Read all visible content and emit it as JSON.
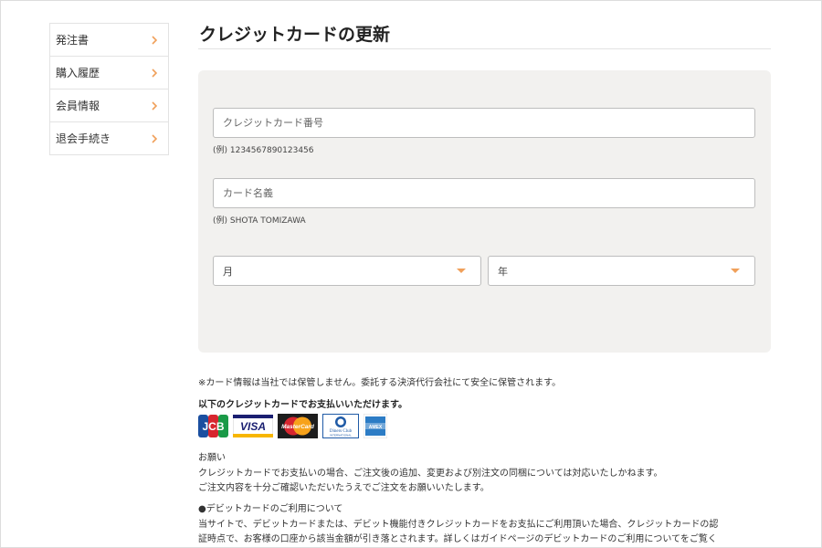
{
  "sidebar": {
    "items": [
      {
        "label": "発注書"
      },
      {
        "label": "購入履歴"
      },
      {
        "label": "会員情報"
      },
      {
        "label": "退会手続き"
      }
    ]
  },
  "page": {
    "title": "クレジットカードの更新"
  },
  "form": {
    "card_number_placeholder": "クレジットカード番号",
    "card_number_hint": "(例) 1234567890123456",
    "card_name_placeholder": "カード名義",
    "card_name_hint": "(例) SHOTA TOMIZAWA",
    "month_label": "月",
    "year_label": "年"
  },
  "info": {
    "notice": "※カード情報は当社では保管しません。委託する決済代行会社にて安全に保管されます。",
    "cards_heading": "以下のクレジットカードでお支払いいただけます。",
    "brands": [
      {
        "label": "JCB",
        "icon": "jcb-logo"
      },
      {
        "label": "VISA",
        "icon": "visa-logo"
      },
      {
        "label": "MasterCard",
        "icon": "mastercard-logo"
      },
      {
        "label": "Diners Club",
        "sublabel": "INTERNATIONAL",
        "icon": "diners-logo"
      },
      {
        "label": "AMEX",
        "icon": "amex-logo"
      }
    ],
    "request_title": "お願い",
    "request_line1": "クレジットカードでお支払いの場合、ご注文後の追加、変更および別注文の同梱については対応いたしかねます。",
    "request_line2": "ご注文内容を十分ご確認いただいたうえでご注文をお願いいたします。",
    "debit_title": "●デビットカードのご利用について",
    "debit_line1": "当サイトで、デビットカードまたは、デビット機能付きクレジットカードをお支払にご利用頂いた場合、クレジットカードの認",
    "debit_line2": "証時点で、お客様の口座から該当金額が引き落とされます。詳しくはガイドページのデビットカードのご利用についてをご覧く"
  },
  "colors": {
    "accent": "#f0a05a",
    "panel_bg": "#f2f1ef"
  }
}
